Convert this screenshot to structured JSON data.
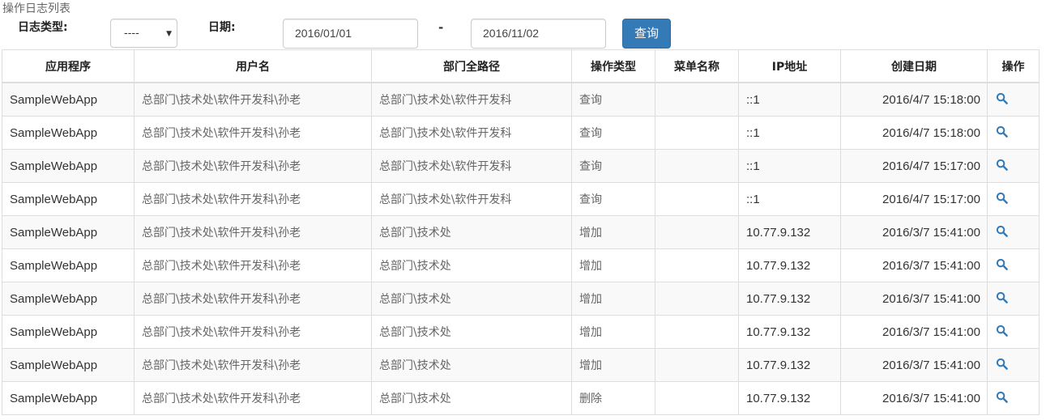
{
  "page": {
    "title": "操作日志列表"
  },
  "filters": {
    "log_type_label": "日志类型:",
    "log_type_value": "----",
    "date_label": "日期:",
    "date_from": "2016/01/01",
    "date_separator": "-",
    "date_to": "2016/11/02",
    "query_button": "查询"
  },
  "table": {
    "headers": [
      "应用程序",
      "用户名",
      "部门全路径",
      "操作类型",
      "菜单名称",
      "IP地址",
      "创建日期",
      "操作"
    ],
    "rows": [
      {
        "app": "SampleWebApp",
        "user": "总部门\\技术处\\软件开发科\\孙老",
        "dept": "总部门\\技术处\\软件开发科",
        "type": "查询",
        "menu": "",
        "ip": "::1",
        "date": "2016/4/7 15:18:00"
      },
      {
        "app": "SampleWebApp",
        "user": "总部门\\技术处\\软件开发科\\孙老",
        "dept": "总部门\\技术处\\软件开发科",
        "type": "查询",
        "menu": "",
        "ip": "::1",
        "date": "2016/4/7 15:18:00"
      },
      {
        "app": "SampleWebApp",
        "user": "总部门\\技术处\\软件开发科\\孙老",
        "dept": "总部门\\技术处\\软件开发科",
        "type": "查询",
        "menu": "",
        "ip": "::1",
        "date": "2016/4/7 15:17:00"
      },
      {
        "app": "SampleWebApp",
        "user": "总部门\\技术处\\软件开发科\\孙老",
        "dept": "总部门\\技术处\\软件开发科",
        "type": "查询",
        "menu": "",
        "ip": "::1",
        "date": "2016/4/7 15:17:00"
      },
      {
        "app": "SampleWebApp",
        "user": "总部门\\技术处\\软件开发科\\孙老",
        "dept": "总部门\\技术处",
        "type": "增加",
        "menu": "",
        "ip": "10.77.9.132",
        "date": "2016/3/7 15:41:00"
      },
      {
        "app": "SampleWebApp",
        "user": "总部门\\技术处\\软件开发科\\孙老",
        "dept": "总部门\\技术处",
        "type": "增加",
        "menu": "",
        "ip": "10.77.9.132",
        "date": "2016/3/7 15:41:00"
      },
      {
        "app": "SampleWebApp",
        "user": "总部门\\技术处\\软件开发科\\孙老",
        "dept": "总部门\\技术处",
        "type": "增加",
        "menu": "",
        "ip": "10.77.9.132",
        "date": "2016/3/7 15:41:00"
      },
      {
        "app": "SampleWebApp",
        "user": "总部门\\技术处\\软件开发科\\孙老",
        "dept": "总部门\\技术处",
        "type": "增加",
        "menu": "",
        "ip": "10.77.9.132",
        "date": "2016/3/7 15:41:00"
      },
      {
        "app": "SampleWebApp",
        "user": "总部门\\技术处\\软件开发科\\孙老",
        "dept": "总部门\\技术处",
        "type": "增加",
        "menu": "",
        "ip": "10.77.9.132",
        "date": "2016/3/7 15:41:00"
      },
      {
        "app": "SampleWebApp",
        "user": "总部门\\技术处\\软件开发科\\孙老",
        "dept": "总部门\\技术处",
        "type": "删除",
        "menu": "",
        "ip": "10.77.9.132",
        "date": "2016/3/7 15:41:00"
      }
    ],
    "action_icon": "search-icon"
  },
  "colors": {
    "primary": "#337ab7",
    "border": "#dddddd",
    "stripe": "#f9f9f9"
  }
}
